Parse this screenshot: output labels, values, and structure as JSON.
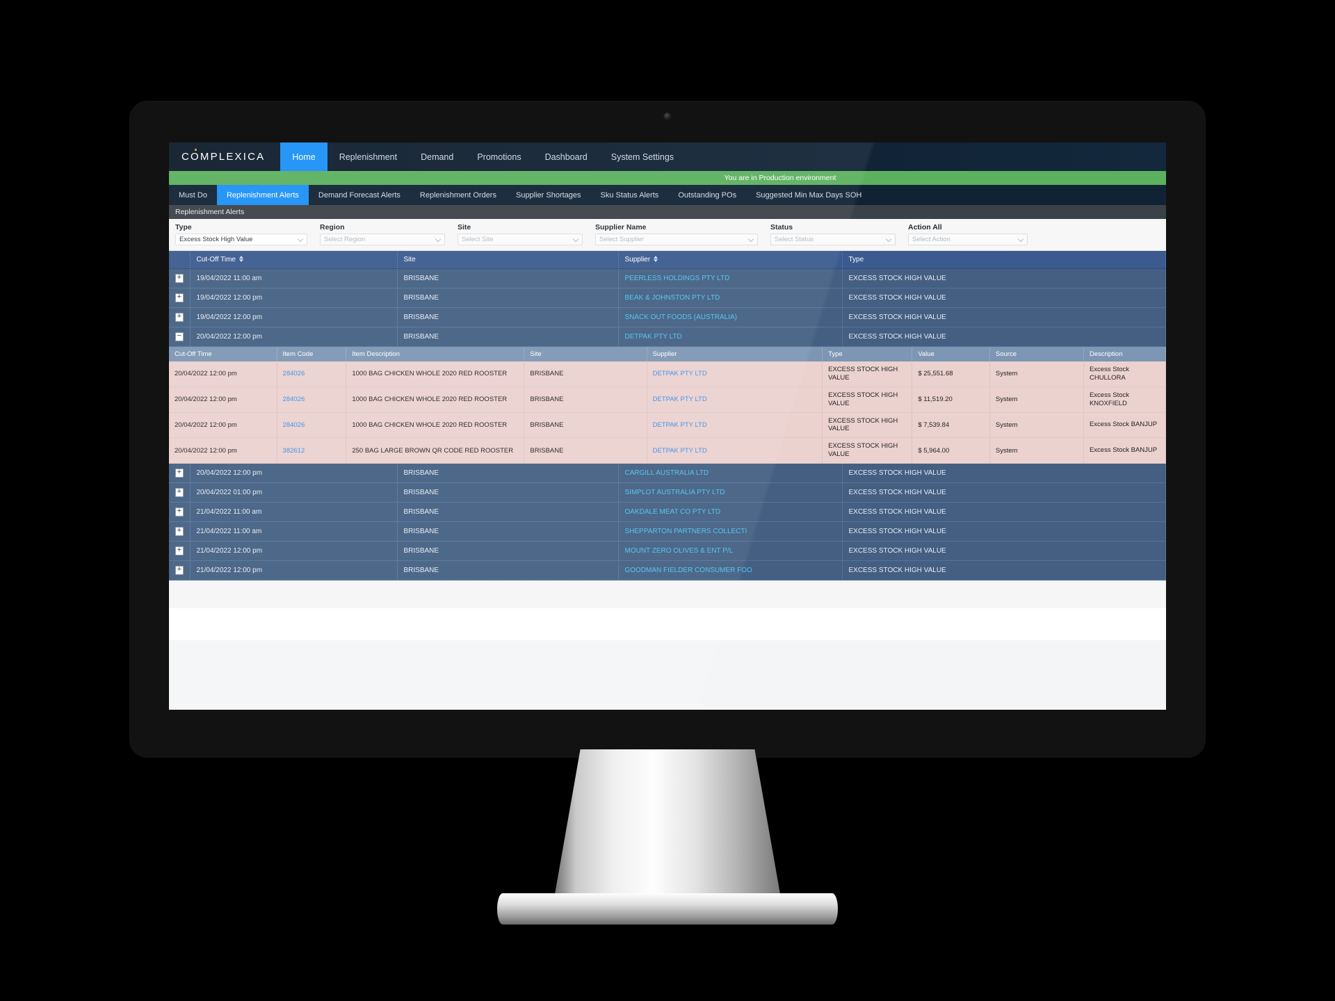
{
  "brand": {
    "name": "COMPLEXICA"
  },
  "topnav": {
    "items": [
      {
        "label": "Home",
        "active": true
      },
      {
        "label": "Replenishment",
        "active": false
      },
      {
        "label": "Demand",
        "active": false
      },
      {
        "label": "Promotions",
        "active": false
      },
      {
        "label": "Dashboard",
        "active": false
      },
      {
        "label": "System Settings",
        "active": false
      }
    ]
  },
  "env_banner": {
    "text": "You are in Production environment",
    "color": "#5cb15f"
  },
  "tabs": [
    {
      "label": "Must Do",
      "active": false
    },
    {
      "label": "Replenishment Alerts",
      "active": true
    },
    {
      "label": "Demand Forecast Alerts",
      "active": false
    },
    {
      "label": "Replenishment Orders",
      "active": false
    },
    {
      "label": "Supplier Shortages",
      "active": false
    },
    {
      "label": "Sku Status Alerts",
      "active": false
    },
    {
      "label": "Outstanding POs",
      "active": false
    },
    {
      "label": "Suggested Min Max Days SOH",
      "active": false
    }
  ],
  "panel": {
    "title": "Replenishment Alerts"
  },
  "filters": [
    {
      "label": "Type",
      "value": "Excess Stock High Value",
      "placeholder": "",
      "is_placeholder": false
    },
    {
      "label": "Region",
      "value": "Select Region",
      "placeholder": "Select Region",
      "is_placeholder": true
    },
    {
      "label": "Site",
      "value": "Select Site",
      "placeholder": "Select Site",
      "is_placeholder": true
    },
    {
      "label": "Supplier Name",
      "value": "Select Supplier",
      "placeholder": "Select Supplier",
      "is_placeholder": true
    },
    {
      "label": "Status",
      "value": "Select Status",
      "placeholder": "Select Status",
      "is_placeholder": true
    },
    {
      "label": "Action All",
      "value": "Select Action",
      "placeholder": "Select Action",
      "is_placeholder": true
    }
  ],
  "parent_table": {
    "columns": [
      {
        "label": "",
        "sortable": false
      },
      {
        "label": "Cut-Off Time",
        "sortable": true
      },
      {
        "label": "Site",
        "sortable": false
      },
      {
        "label": "Supplier",
        "sortable": true
      },
      {
        "label": "Type",
        "sortable": false
      }
    ],
    "rows": [
      {
        "expanded": false,
        "cut_off_time": "19/04/2022 11:00 am",
        "site": "BRISBANE",
        "supplier": "PEERLESS HOLDINGS PTY LTD",
        "type": "EXCESS STOCK HIGH VALUE"
      },
      {
        "expanded": false,
        "cut_off_time": "19/04/2022 12:00 pm",
        "site": "BRISBANE",
        "supplier": "BEAK & JOHNSTON PTY LTD",
        "type": "EXCESS STOCK HIGH VALUE"
      },
      {
        "expanded": false,
        "cut_off_time": "19/04/2022 12:00 pm",
        "site": "BRISBANE",
        "supplier": "SNACK OUT FOODS (AUSTRALIA)",
        "type": "EXCESS STOCK HIGH VALUE"
      },
      {
        "expanded": true,
        "cut_off_time": "20/04/2022 12:00 pm",
        "site": "BRISBANE",
        "supplier": "DETPAK PTY LTD",
        "type": "EXCESS STOCK HIGH VALUE"
      },
      {
        "expanded": false,
        "cut_off_time": "20/04/2022 12:00 pm",
        "site": "BRISBANE",
        "supplier": "CARGILL AUSTRALIA LTD",
        "type": "EXCESS STOCK HIGH VALUE"
      },
      {
        "expanded": false,
        "cut_off_time": "20/04/2022 01:00 pm",
        "site": "BRISBANE",
        "supplier": "SIMPLOT AUSTRALIA PTY LTD",
        "type": "EXCESS STOCK HIGH VALUE"
      },
      {
        "expanded": false,
        "cut_off_time": "21/04/2022 11:00 am",
        "site": "BRISBANE",
        "supplier": "OAKDALE MEAT CO PTY LTD",
        "type": "EXCESS STOCK HIGH VALUE"
      },
      {
        "expanded": false,
        "cut_off_time": "21/04/2022 11:00 am",
        "site": "BRISBANE",
        "supplier": "SHEPPARTON PARTNERS COLLECTI",
        "type": "EXCESS STOCK HIGH VALUE"
      },
      {
        "expanded": false,
        "cut_off_time": "21/04/2022 12:00 pm",
        "site": "BRISBANE",
        "supplier": "MOUNT ZERO OLIVES & ENT P/L",
        "type": "EXCESS STOCK HIGH VALUE"
      },
      {
        "expanded": false,
        "cut_off_time": "21/04/2022 12:00 pm",
        "site": "BRISBANE",
        "supplier": "GOODMAN FIELDER CONSUMER FOO",
        "type": "EXCESS STOCK HIGH VALUE"
      }
    ],
    "expand_icon_collapsed": "+",
    "expand_icon_expanded": "−"
  },
  "child_table": {
    "after_parent_row_index": 3,
    "columns": [
      "Cut-Off Time",
      "Item Code",
      "Item Description",
      "Site",
      "Supplier",
      "Type",
      "Value",
      "Source",
      "Description"
    ],
    "rows": [
      {
        "cut_off_time": "20/04/2022 12:00 pm",
        "item_code": "284026",
        "item_description": "1000 BAG CHICKEN WHOLE 2020 RED ROOSTER",
        "site": "BRISBANE",
        "supplier": "DETPAK PTY LTD",
        "type": "EXCESS STOCK HIGH VALUE",
        "value": "$ 25,551.68",
        "source": "System",
        "description": "Excess Stock CHULLORA"
      },
      {
        "cut_off_time": "20/04/2022 12:00 pm",
        "item_code": "284026",
        "item_description": "1000 BAG CHICKEN WHOLE 2020 RED ROOSTER",
        "site": "BRISBANE",
        "supplier": "DETPAK PTY LTD",
        "type": "EXCESS STOCK HIGH VALUE",
        "value": "$ 11,519.20",
        "source": "System",
        "description": "Excess Stock KNOXFIELD"
      },
      {
        "cut_off_time": "20/04/2022 12:00 pm",
        "item_code": "284026",
        "item_description": "1000 BAG CHICKEN WHOLE 2020 RED ROOSTER",
        "site": "BRISBANE",
        "supplier": "DETPAK PTY LTD",
        "type": "EXCESS STOCK HIGH VALUE",
        "value": "$ 7,539.84",
        "source": "System",
        "description": "Excess Stock BANJUP"
      },
      {
        "cut_off_time": "20/04/2022 12:00 pm",
        "item_code": "382612",
        "item_description": "250 BAG LARGE BROWN QR CODE RED ROOSTER",
        "site": "BRISBANE",
        "supplier": "DETPAK PTY LTD",
        "type": "EXCESS STOCK HIGH VALUE",
        "value": "$ 5,964.00",
        "source": "System",
        "description": "Excess Stock BANJUP"
      }
    ]
  },
  "colors": {
    "accent_blue": "#1b90f7",
    "topnav_bg": "#102234",
    "env_green": "#5cb15f",
    "header_blue": "#3b5a8f",
    "parent_row_blue": "#445f82",
    "child_row_pink": "#ebd2cf",
    "child_header_blue": "#7d96b4",
    "link_cyan": "#4cc3f0"
  }
}
